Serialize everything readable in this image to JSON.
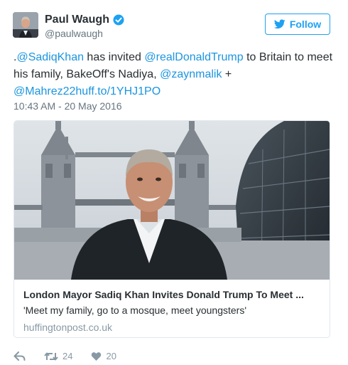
{
  "user": {
    "name": "Paul Waugh",
    "handle": "@paulwaugh"
  },
  "follow_label": "Follow",
  "tweet": {
    "prefix": ".",
    "mention_1": "@SadiqKhan",
    "text_1": " has invited ",
    "mention_2": "@realDonaldTrump",
    "text_2": " to Britain to meet his family, BakeOff's Nadiya, ",
    "mention_3": "@zaynmalik",
    "text_3": " + ",
    "mention_4": "@Mahrez22",
    "link": "huff.to/1YHJ1PO"
  },
  "timestamp": "10:43 AM - 20 May 2016",
  "card": {
    "title": "London Mayor Sadiq Khan Invites Donald Trump To Meet ...",
    "description": "'Meet my family, go to a mosque, meet youngsters'",
    "domain": "huffingtonpost.co.uk"
  },
  "actions": {
    "retweet_count": "24",
    "like_count": "20"
  },
  "colors": {
    "link": "#1b95e0",
    "follow": "#1da1f2",
    "muted": "#66757f"
  },
  "icons": {
    "verified": "verified-badge-icon",
    "follow": "twitter-bird-icon",
    "reply": "reply-icon",
    "retweet": "retweet-icon",
    "like": "heart-icon"
  }
}
